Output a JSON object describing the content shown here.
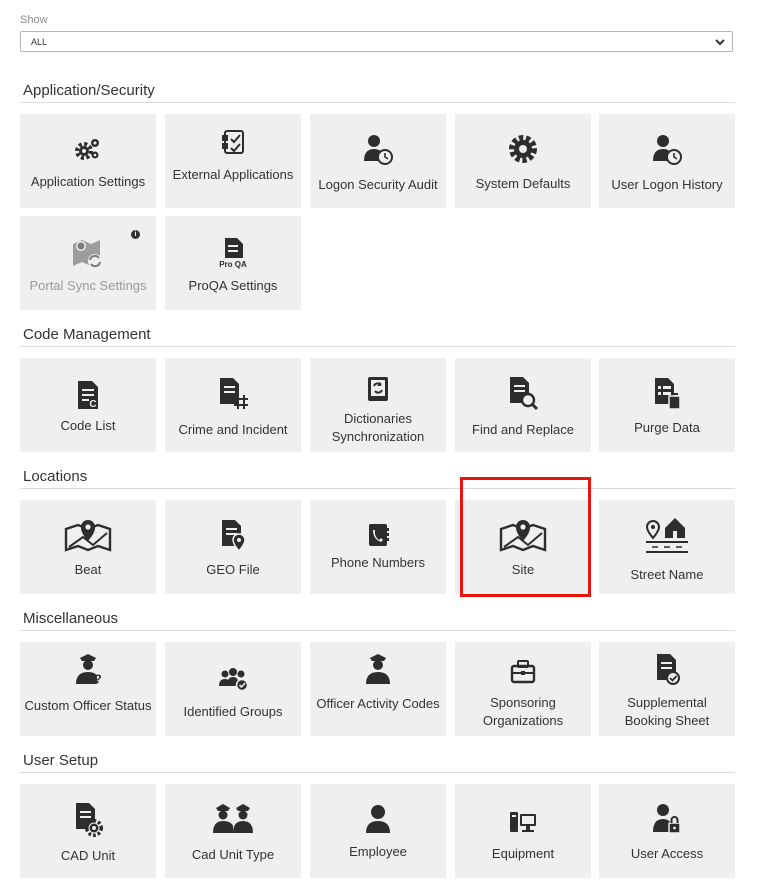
{
  "filter": {
    "label": "Show",
    "value": "ALL"
  },
  "sections": {
    "application_security": {
      "title": "Application/Security",
      "tiles": [
        {
          "label": "Application Settings",
          "icon": "gears-icon"
        },
        {
          "label": "External Applications",
          "icon": "external-apps-icon"
        },
        {
          "label": "Logon Security Audit",
          "icon": "user-clock-icon"
        },
        {
          "label": "System Defaults",
          "icon": "gear-icon"
        },
        {
          "label": "User Logon History",
          "icon": "user-clock-icon"
        },
        {
          "label": "Portal Sync Settings",
          "icon": "map-sync-icon",
          "disabled": true
        },
        {
          "label": "ProQA Settings",
          "icon": "proqa-document-icon",
          "icon_text": "Pro QA"
        }
      ]
    },
    "code_management": {
      "title": "Code Management",
      "tiles": [
        {
          "label": "Code List",
          "icon": "code-list-icon"
        },
        {
          "label": "Crime and Incident",
          "icon": "crime-incident-icon"
        },
        {
          "label": "Dictionaries Synchronization",
          "icon": "dictionary-sync-icon"
        },
        {
          "label": "Find and Replace",
          "icon": "find-replace-icon"
        },
        {
          "label": "Purge Data",
          "icon": "purge-data-icon"
        }
      ]
    },
    "locations": {
      "title": "Locations",
      "tiles": [
        {
          "label": "Beat",
          "icon": "map-pin-icon"
        },
        {
          "label": "GEO File",
          "icon": "geo-file-icon"
        },
        {
          "label": "Phone Numbers",
          "icon": "phone-book-icon"
        },
        {
          "label": "Site",
          "icon": "map-pin-icon"
        },
        {
          "label": "Street Name",
          "icon": "street-house-icon"
        }
      ]
    },
    "miscellaneous": {
      "title": "Miscellaneous",
      "tiles": [
        {
          "label": "Custom Officer Status",
          "icon": "officer-question-icon"
        },
        {
          "label": "Identified Groups",
          "icon": "group-check-icon"
        },
        {
          "label": "Officer Activity Codes",
          "icon": "officer-icon"
        },
        {
          "label": "Sponsoring Organizations",
          "icon": "briefcase-icon"
        },
        {
          "label": "Supplemental Booking Sheet",
          "icon": "document-check-icon"
        }
      ]
    },
    "user_setup": {
      "title": "User Setup",
      "tiles": [
        {
          "label": "CAD Unit",
          "icon": "document-gear-icon"
        },
        {
          "label": "Cad Unit Type",
          "icon": "officers-icon"
        },
        {
          "label": "Employee",
          "icon": "user-icon"
        },
        {
          "label": "Equipment",
          "icon": "computer-icon"
        },
        {
          "label": "User Access",
          "icon": "user-lock-icon"
        }
      ]
    }
  },
  "highlighted_tile": "Site"
}
